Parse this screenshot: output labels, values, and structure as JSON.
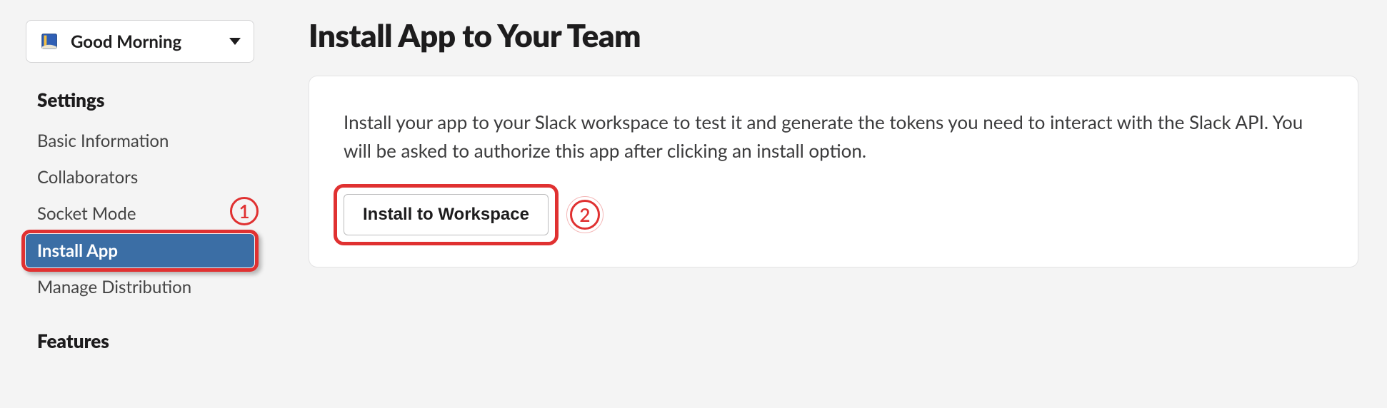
{
  "app_picker": {
    "label": "Good Morning"
  },
  "sidebar": {
    "heading_settings": "Settings",
    "heading_features": "Features",
    "items": {
      "basic_information": "Basic Information",
      "collaborators": "Collaborators",
      "socket_mode": "Socket Mode",
      "install_app": "Install App",
      "manage_distribution": "Manage Distribution"
    }
  },
  "main": {
    "title": "Install App to Your Team",
    "body": "Install your app to your Slack workspace to test it and generate the tokens you need to interact with the Slack API. You will be asked to authorize this app after clicking an install option.",
    "install_button": "Install to Workspace"
  },
  "annotations": {
    "one": "1",
    "two": "2"
  }
}
